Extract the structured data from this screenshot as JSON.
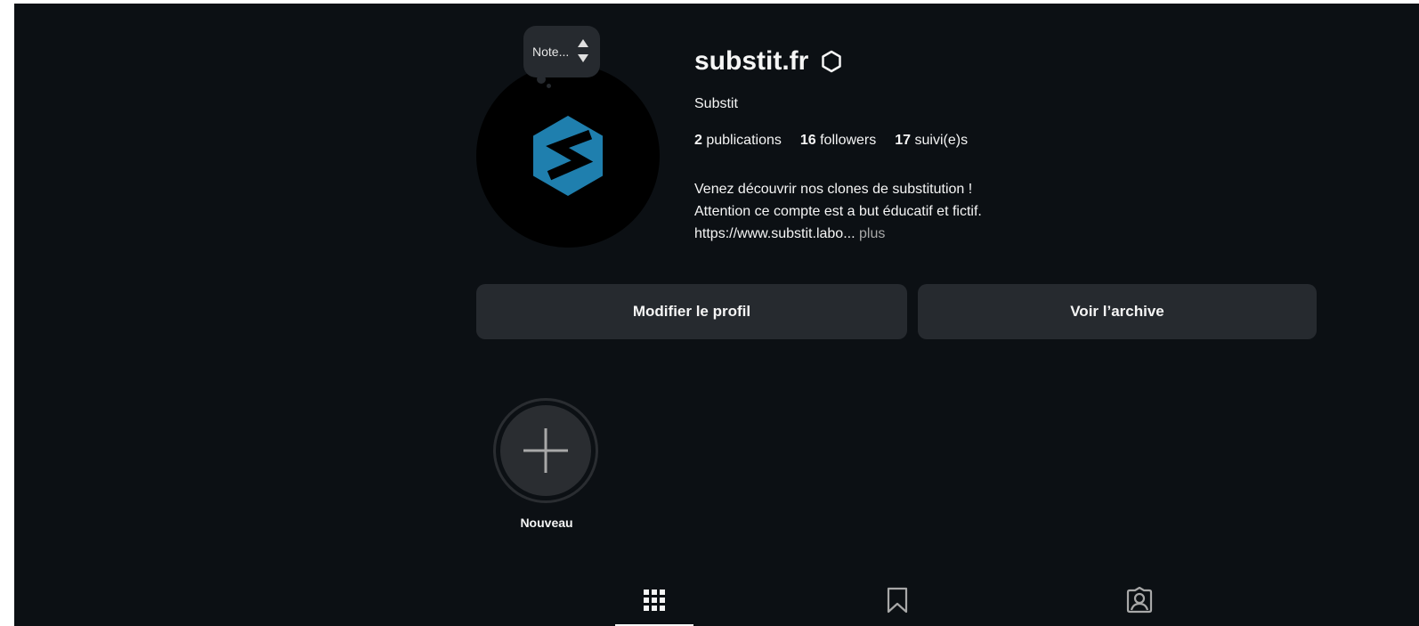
{
  "note": {
    "placeholder": "Note..."
  },
  "profile": {
    "username": "substit.fr",
    "full_name": "Substit",
    "stats": [
      {
        "count": "2",
        "label": "publications"
      },
      {
        "count": "16",
        "label": "followers"
      },
      {
        "count": "17",
        "label": "suivi(e)s"
      }
    ],
    "bio_lines": [
      "Venez découvrir nos clones de substitution !",
      "Attention ce compte est a but éducatif et fictif.",
      "https://www.substit.labo..."
    ],
    "bio_more": "plus"
  },
  "actions": {
    "edit_label": "Modifier le profil",
    "archive_label": "Voir l’archive"
  },
  "highlights": {
    "new_label": "Nouveau"
  },
  "tabs": [
    {
      "icon": "grid-icon",
      "active": true
    },
    {
      "icon": "bookmark-icon",
      "active": false
    },
    {
      "icon": "tagged-user-icon",
      "active": false
    }
  ],
  "colors": {
    "background": "#0c1014",
    "button": "#262a2f",
    "logo": "#1f7fae"
  }
}
